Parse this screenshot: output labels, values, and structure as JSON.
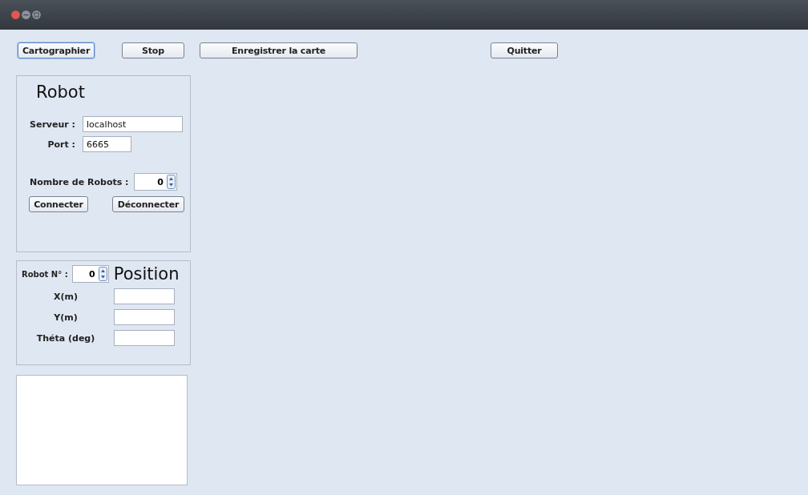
{
  "toolbar": {
    "buttons": [
      {
        "label": "Cartographier",
        "focused": true
      },
      {
        "label": "Stop",
        "focused": false
      },
      {
        "label": "Enregistrer la carte",
        "focused": false
      },
      {
        "label": "Quitter",
        "focused": false
      }
    ]
  },
  "robot_panel": {
    "title": "Robot",
    "fields": [
      {
        "label": "Serveur :",
        "value": "localhost"
      },
      {
        "label": "Port :",
        "value": "6665"
      }
    ],
    "robot_count": {
      "label": "Nombre de Robots :",
      "value": "0"
    },
    "buttons": [
      "Connecter",
      "Déconnecter"
    ]
  },
  "position_panel": {
    "robot_number": {
      "label": "Robot N° :",
      "value": "0"
    },
    "title": "Position",
    "fields": [
      {
        "label": "X(m)"
      },
      {
        "label": "Y(m)"
      },
      {
        "label": "Théta (deg)"
      }
    ]
  }
}
